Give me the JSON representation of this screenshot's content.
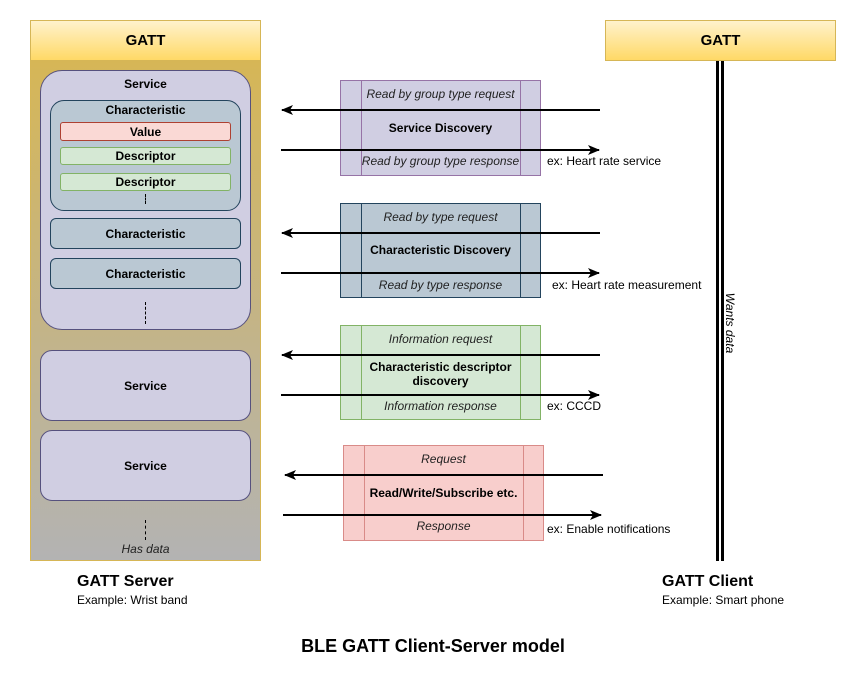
{
  "title": "BLE GATT Client-Server model",
  "server": {
    "header": "GATT",
    "role_title": "GATT Server",
    "role_example": "Example: Wrist band",
    "footer_label": "Has data",
    "service_expanded": {
      "label": "Service",
      "characteristic_expanded": {
        "label": "Characteristic",
        "value_label": "Value",
        "descriptors": [
          "Descriptor",
          "Descriptor"
        ]
      },
      "characteristics": [
        "Characteristic",
        "Characteristic"
      ]
    },
    "services": [
      "Service",
      "Service"
    ]
  },
  "client": {
    "header": "GATT",
    "role_title": "GATT Client",
    "role_example": "Example: Smart phone",
    "lifeline_label": "Wants data"
  },
  "exchanges": [
    {
      "title": "Service Discovery",
      "request": "Read by group type request",
      "response": "Read by group type response",
      "example": "ex: Heart rate service",
      "color": "#d0cee2"
    },
    {
      "title": "Characteristic Discovery",
      "request": "Read by type request",
      "response": "Read by type response",
      "example": "ex: Heart rate measurement",
      "color": "#bac8d3"
    },
    {
      "title": "Characteristic descriptor discovery",
      "request": "Information request",
      "response": "Information response",
      "example": "ex: CCCD",
      "color": "#d5e8d4"
    },
    {
      "title": "Read/Write/Subscribe etc.",
      "request": "Request",
      "response": "Response",
      "example": "ex: Enable notifications",
      "color": "#f8cecc"
    }
  ]
}
